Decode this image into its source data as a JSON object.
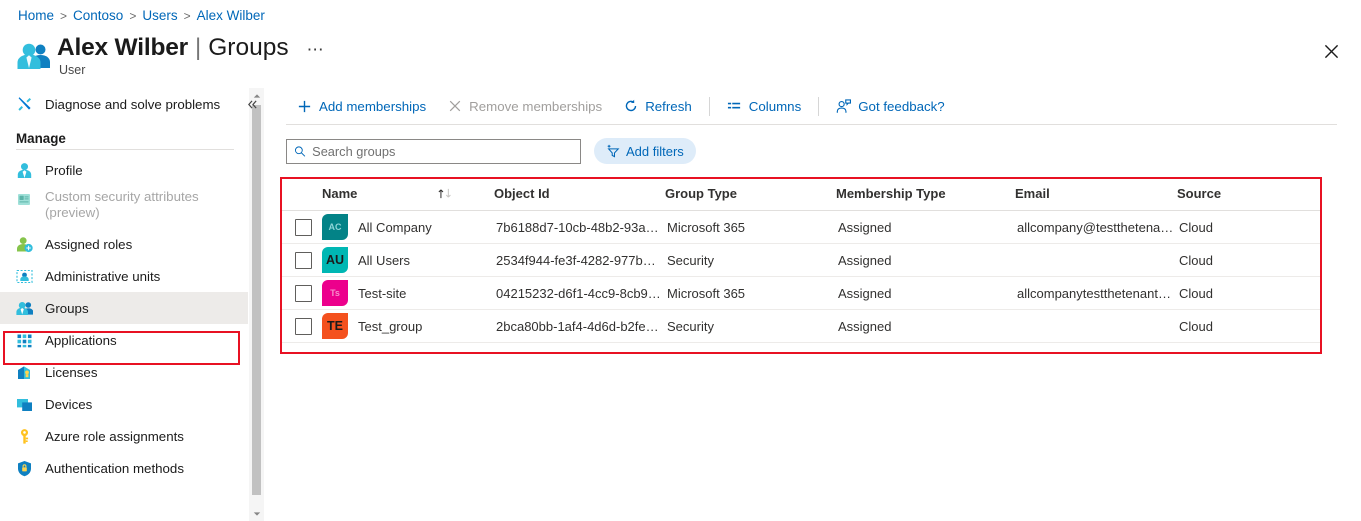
{
  "breadcrumb": {
    "items": [
      "Home",
      "Contoso",
      "Users",
      "Alex Wilber"
    ],
    "separator": ">"
  },
  "header": {
    "title": "Alex Wilber",
    "separator": "|",
    "section": "Groups",
    "ellipsis": "⋯",
    "caption": "User",
    "close_icon": "close-icon"
  },
  "sidebar": {
    "diagnose": {
      "label": "Diagnose and solve problems",
      "icon": "tools-icon"
    },
    "manage_header": "Manage",
    "items": [
      {
        "label": "Profile",
        "icon": "user-icon",
        "disabled": false,
        "selected": false
      },
      {
        "label": "Custom security attributes",
        "label2": "(preview)",
        "icon": "attributes-icon",
        "disabled": true,
        "selected": false
      },
      {
        "label": "Assigned roles",
        "icon": "assigned-roles-icon",
        "disabled": false,
        "selected": false
      },
      {
        "label": "Administrative units",
        "icon": "administrative-units-icon",
        "disabled": false,
        "selected": false
      },
      {
        "label": "Groups",
        "icon": "groups-icon",
        "disabled": false,
        "selected": true
      },
      {
        "label": "Applications",
        "icon": "applications-icon",
        "disabled": false,
        "selected": false
      },
      {
        "label": "Licenses",
        "icon": "licenses-icon",
        "disabled": false,
        "selected": false
      },
      {
        "label": "Devices",
        "icon": "devices-icon",
        "disabled": false,
        "selected": false
      },
      {
        "label": "Azure role assignments",
        "icon": "key-icon",
        "disabled": false,
        "selected": false
      },
      {
        "label": "Authentication methods",
        "icon": "shield-icon",
        "disabled": false,
        "selected": false
      }
    ]
  },
  "toolbar": {
    "add_memberships": "Add memberships",
    "remove_memberships": "Remove memberships",
    "refresh": "Refresh",
    "columns": "Columns",
    "got_feedback": "Got feedback?"
  },
  "filters": {
    "search_placeholder": "Search groups",
    "search_value": "",
    "add_filters": "Add filters"
  },
  "table": {
    "columns": [
      "Name",
      "Object Id",
      "Group Type",
      "Membership Type",
      "Email",
      "Source"
    ],
    "sort_column": "Name",
    "sort_direction": "ascending",
    "rows": [
      {
        "checked": false,
        "initials": "AC",
        "avatar_bg": "#038387",
        "avatar_fg": "#8fd6d8",
        "avatar_size": "sm",
        "name": "All Company",
        "object_id": "7b6188d7-10cb-48b2-93a…",
        "group_type": "Microsoft 365",
        "membership_type": "Assigned",
        "email": "allcompany@testthetenan…",
        "source": "Cloud"
      },
      {
        "checked": false,
        "initials": "AU",
        "avatar_bg": "#00b7b3",
        "avatar_fg": "#1b1b1b",
        "avatar_size": "lg",
        "name": "All Users",
        "object_id": "2534f944-fe3f-4282-977b…",
        "group_type": "Security",
        "membership_type": "Assigned",
        "email": "",
        "source": "Cloud"
      },
      {
        "checked": false,
        "initials": "Ts",
        "avatar_bg": "#ec008c",
        "avatar_fg": "#f78fcb",
        "avatar_size": "sm",
        "name": "Test-site",
        "object_id": "04215232-d6f1-4cc9-8cb9…",
        "group_type": "Microsoft 365",
        "membership_type": "Assigned",
        "email": "allcompanytestthetenant3…",
        "source": "Cloud"
      },
      {
        "checked": false,
        "initials": "TE",
        "avatar_bg": "#f4511e",
        "avatar_fg": "#1b1b1b",
        "avatar_size": "lg",
        "name": "Test_group",
        "object_id": "2bca80bb-1af4-4d6d-b2fe…",
        "group_type": "Security",
        "membership_type": "Assigned",
        "email": "",
        "source": "Cloud"
      }
    ]
  },
  "colors": {
    "accent": "#0067b8",
    "highlight_border": "#e81123",
    "selected_row_bg": "#edebe9",
    "filter_pill_bg": "#deecf9"
  }
}
